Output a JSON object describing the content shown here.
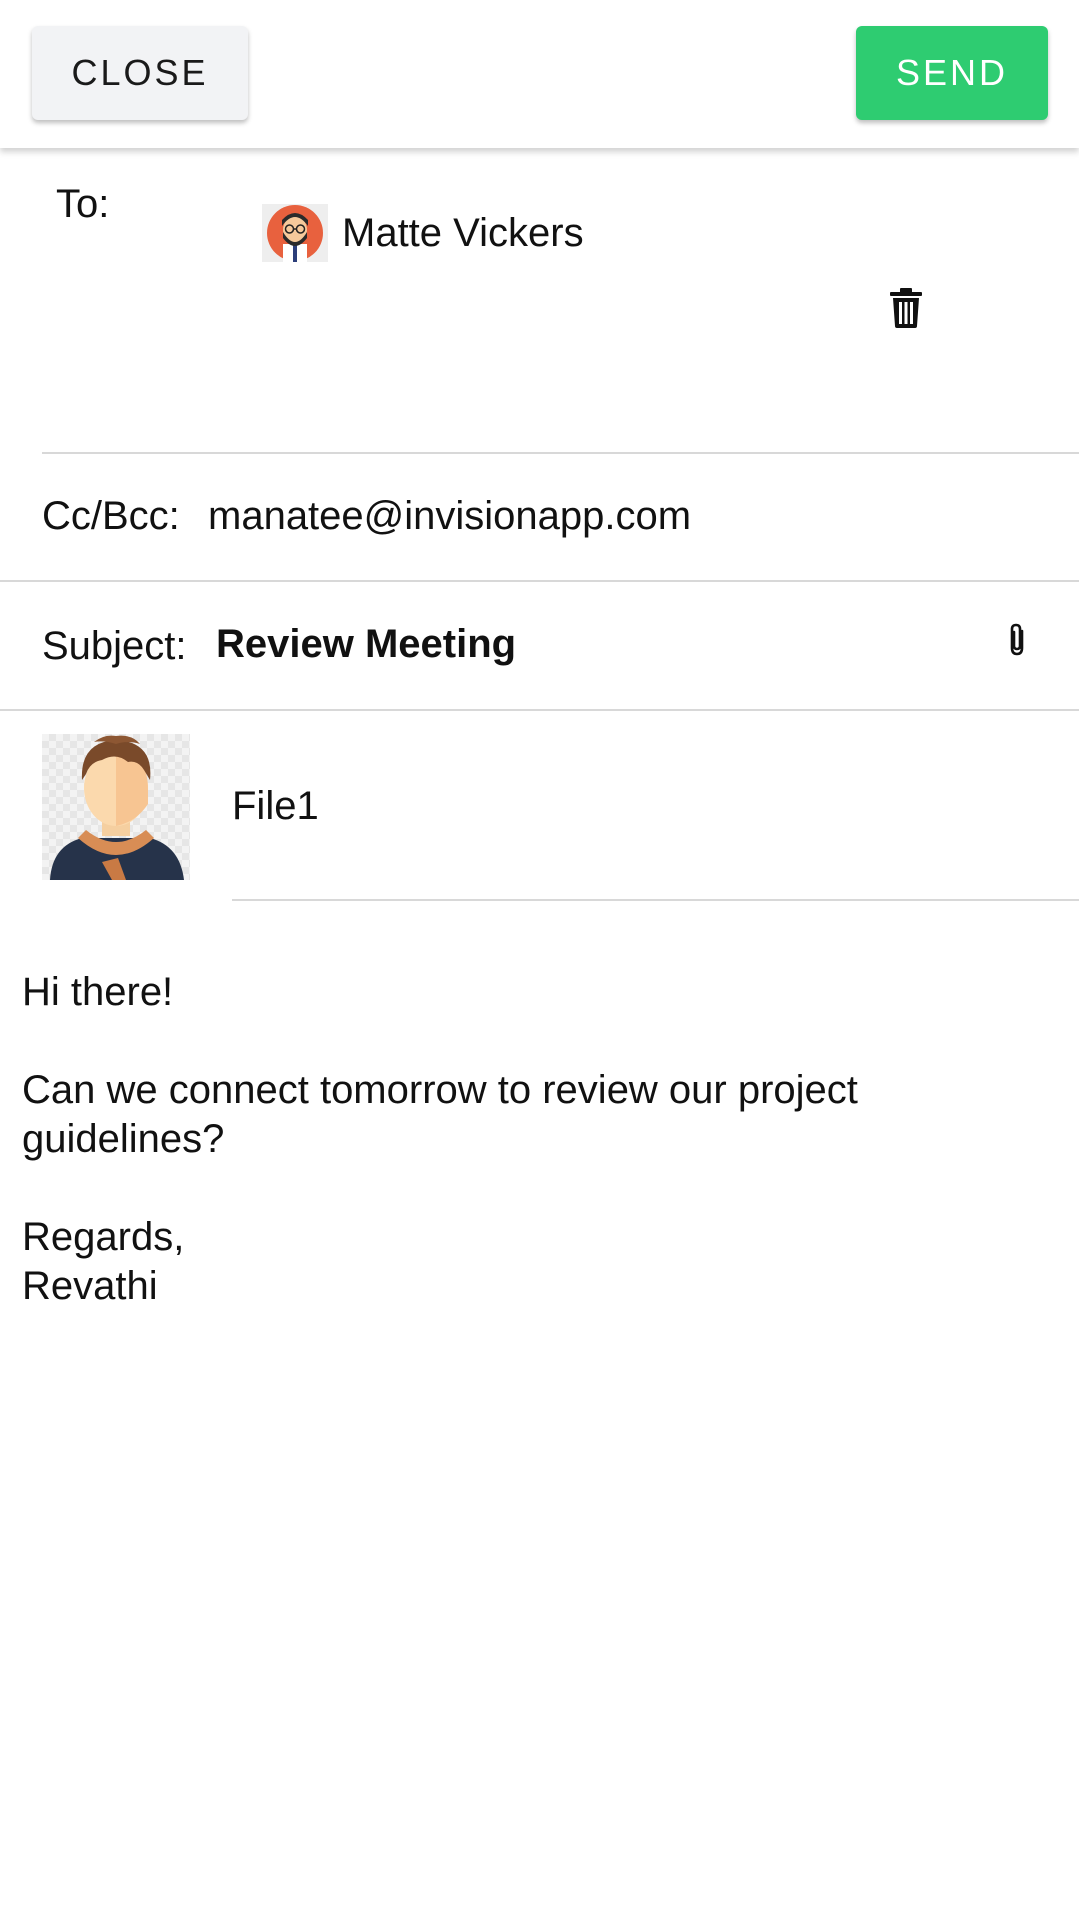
{
  "header": {
    "close_label": "CLOSE",
    "send_label": "SEND",
    "send_color": "#2ecc71"
  },
  "to": {
    "label": "To:",
    "recipient_name": "Matte Vickers",
    "recipient_avatar_icon": "bearded-man-avatar-icon",
    "remove_icon": "trash-icon"
  },
  "cc": {
    "label": "Cc/Bcc:",
    "value": "manatee@invisionapp.com"
  },
  "subject": {
    "label": "Subject:",
    "value": "Review Meeting",
    "attach_icon": "paperclip-icon"
  },
  "attachment": {
    "name": "File1",
    "thumbnail_icon": "man-with-scarf-avatar-icon"
  },
  "body": {
    "greeting": "Hi there!",
    "line1": "Can we connect tomorrow to review our project",
    "line2": "guidelines?",
    "closing": "Regards,",
    "signature": "Revathi"
  }
}
